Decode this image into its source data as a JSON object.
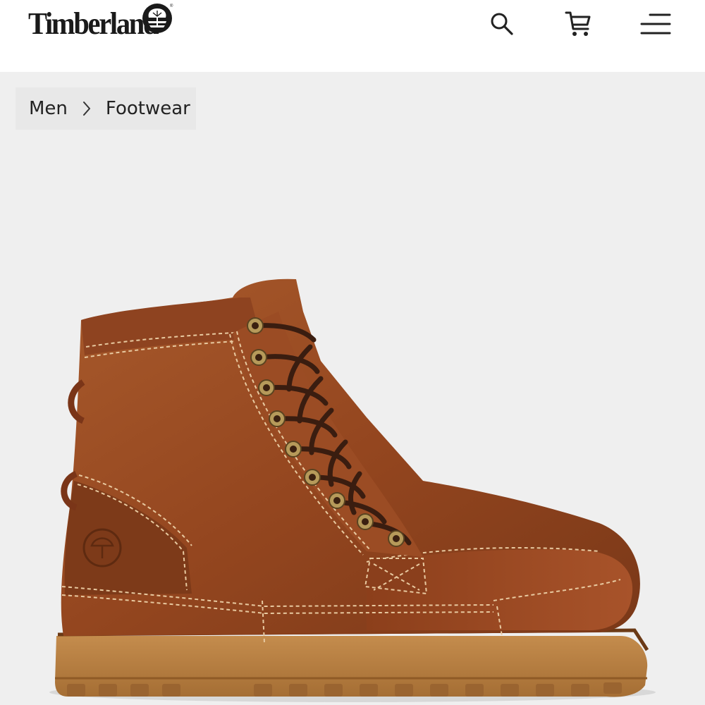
{
  "header": {
    "brand": "Timberland",
    "icons": {
      "search": "search-icon",
      "cart": "cart-icon",
      "menu": "menu-icon"
    }
  },
  "breadcrumb": {
    "items": [
      "Men",
      "Footwear"
    ],
    "separator_icon": "chevron-right-icon"
  },
  "product": {
    "image": "brown-leather-lace-up-boot"
  },
  "colors": {
    "background": "#efefef",
    "text": "#222222",
    "leather": "#9a4a22",
    "sole": "#b07a3e"
  }
}
